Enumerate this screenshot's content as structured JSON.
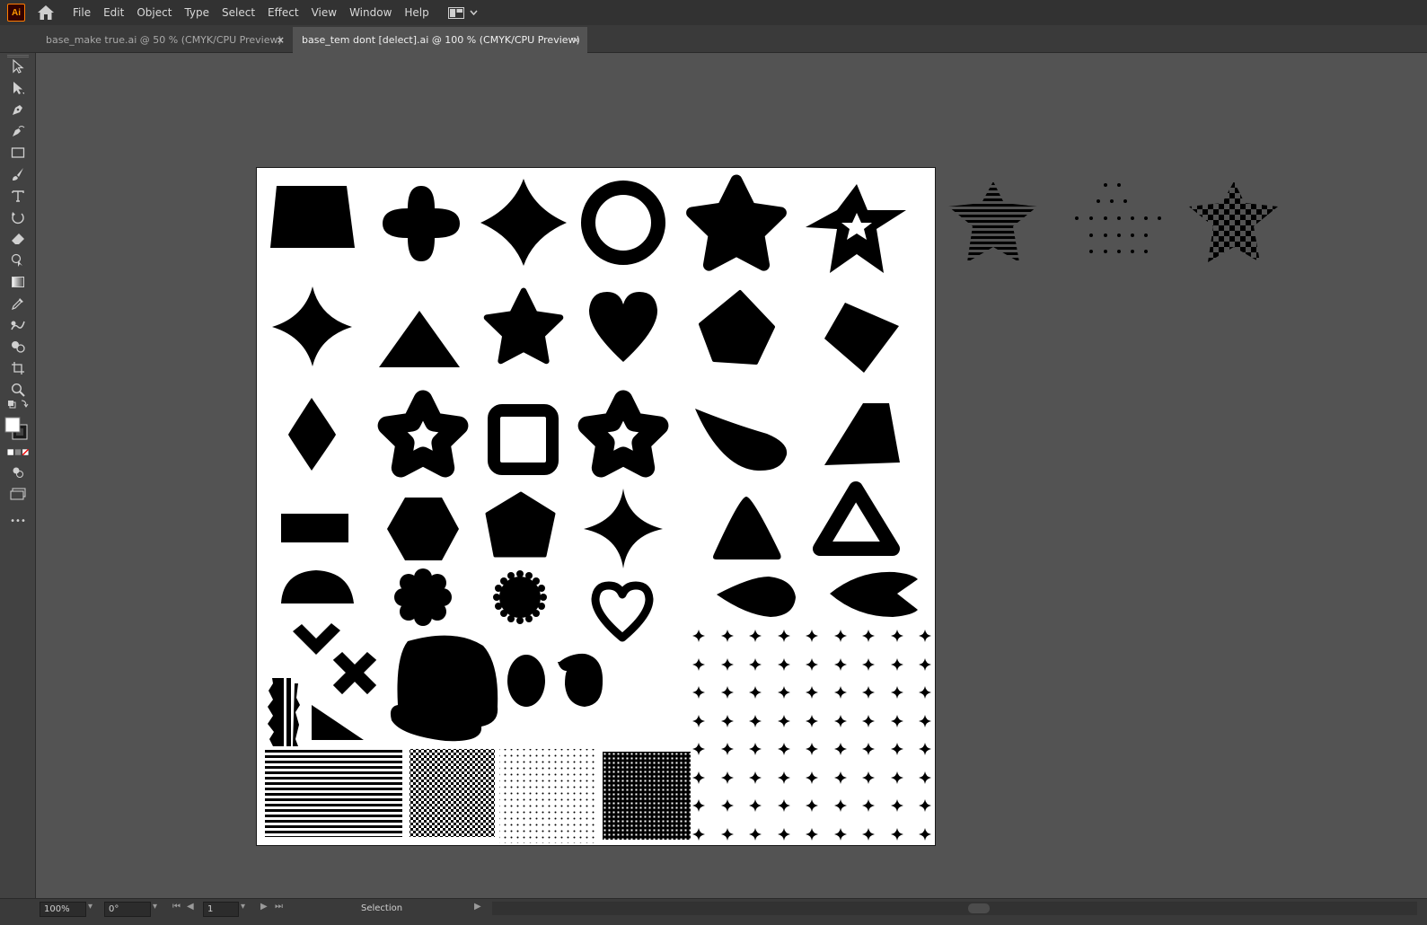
{
  "app": {
    "logo_text": "Ai"
  },
  "menu": [
    "File",
    "Edit",
    "Object",
    "Type",
    "Select",
    "Effect",
    "View",
    "Window",
    "Help"
  ],
  "tabs": [
    {
      "title": "base_make true.ai @ 50 % (CMYK/CPU Preview)",
      "close": "×",
      "active": false
    },
    {
      "title": "base_tem dont [delect].ai @ 100 % (CMYK/CPU Preview)",
      "close": "×",
      "active": true
    }
  ],
  "tools": [
    "selection-tool-icon",
    "direct-selection-tool-icon",
    "pen-tool-icon",
    "curvature-tool-icon",
    "rectangle-tool-icon",
    "paintbrush-tool-icon",
    "type-tool-icon",
    "rotate-tool-icon",
    "eraser-tool-icon",
    "puppet-warp-tool-icon",
    "gradient-tool-icon",
    "eyedropper-tool-icon",
    "blend-tool-icon",
    "shape-builder-tool-icon",
    "artboard-tool-icon",
    "zoom-tool-icon"
  ],
  "toolbar_more": "•••",
  "statusbar": {
    "zoom": "100%",
    "rotation": "0°",
    "artboard_number": "1",
    "current_tool": "Selection"
  },
  "colors": {
    "menubar_bg": "#323232",
    "canvas_bg": "#535353",
    "artboard_bg": "#ffffff",
    "shape_fill": "#000000"
  }
}
